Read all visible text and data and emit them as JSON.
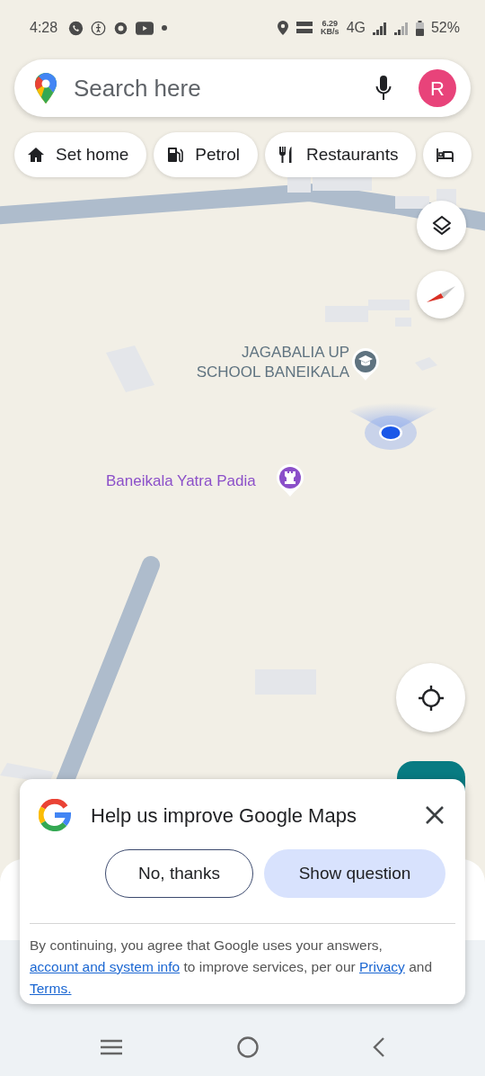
{
  "status_bar": {
    "time": "4:28",
    "speed_value": "6.29",
    "speed_unit": "KB/s",
    "network": "4G",
    "battery": "52%"
  },
  "search": {
    "placeholder": "Search here",
    "avatar_initial": "R"
  },
  "chips": [
    {
      "kind": "home",
      "label": "Set home"
    },
    {
      "kind": "fuel",
      "label": "Petrol"
    },
    {
      "kind": "food",
      "label": "Restaurants"
    },
    {
      "kind": "bed"
    }
  ],
  "places": [
    {
      "kind": "school",
      "label": "JAGABALIA UP SCHOOL BANEIKALA",
      "color": "#5f7380"
    },
    {
      "kind": "landmark",
      "label": "Baneikala Yatra Padia",
      "color": "#8b4fc9"
    }
  ],
  "dialog": {
    "title": "Help us improve Google Maps",
    "buttons": [
      {
        "kind": "outline",
        "label": "No, thanks"
      },
      {
        "kind": "tonal",
        "label": "Show question"
      }
    ],
    "disclaimer": [
      {
        "kind": "text",
        "text": "By continuing, you agree that Google uses your answers, "
      },
      {
        "kind": "link",
        "text": "account and system info"
      },
      {
        "kind": "text",
        "text": " to improve services, per our "
      },
      {
        "kind": "link",
        "text": "Privacy"
      },
      {
        "kind": "text",
        "text": " and "
      },
      {
        "kind": "link",
        "text": "Terms."
      }
    ]
  }
}
